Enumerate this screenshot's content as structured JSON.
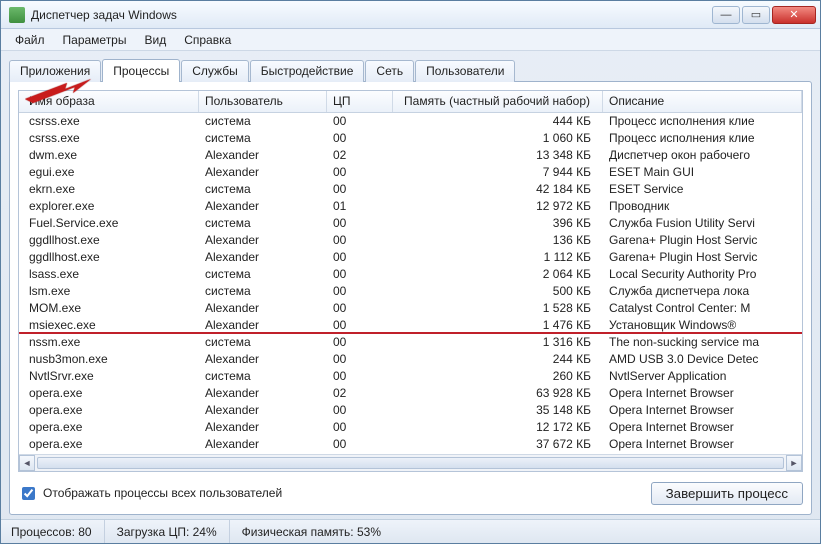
{
  "window": {
    "title": "Диспетчер задач Windows"
  },
  "menu": [
    "Файл",
    "Параметры",
    "Вид",
    "Справка"
  ],
  "tabs": [
    {
      "label": "Приложения",
      "active": false
    },
    {
      "label": "Процессы",
      "active": true
    },
    {
      "label": "Службы",
      "active": false
    },
    {
      "label": "Быстродействие",
      "active": false
    },
    {
      "label": "Сеть",
      "active": false
    },
    {
      "label": "Пользователи",
      "active": false
    }
  ],
  "columns": {
    "name": "Имя образа",
    "user": "Пользователь",
    "cpu": "ЦП",
    "mem": "Память (частный рабочий набор)",
    "desc": "Описание"
  },
  "processes": [
    {
      "name": "csrss.exe",
      "user": "система",
      "cpu": "00",
      "mem": "444 КБ",
      "desc": "Процесс исполнения клие"
    },
    {
      "name": "csrss.exe",
      "user": "система",
      "cpu": "00",
      "mem": "1 060 КБ",
      "desc": "Процесс исполнения клие"
    },
    {
      "name": "dwm.exe",
      "user": "Alexander",
      "cpu": "02",
      "mem": "13 348 КБ",
      "desc": "Диспетчер окон рабочего"
    },
    {
      "name": "egui.exe",
      "user": "Alexander",
      "cpu": "00",
      "mem": "7 944 КБ",
      "desc": "ESET Main GUI"
    },
    {
      "name": "ekrn.exe",
      "user": "система",
      "cpu": "00",
      "mem": "42 184 КБ",
      "desc": "ESET Service"
    },
    {
      "name": "explorer.exe",
      "user": "Alexander",
      "cpu": "01",
      "mem": "12 972 КБ",
      "desc": "Проводник"
    },
    {
      "name": "Fuel.Service.exe",
      "user": "система",
      "cpu": "00",
      "mem": "396 КБ",
      "desc": "Служба Fusion Utility Servi"
    },
    {
      "name": "ggdllhost.exe",
      "user": "Alexander",
      "cpu": "00",
      "mem": "136 КБ",
      "desc": "Garena+ Plugin Host Servic"
    },
    {
      "name": "ggdllhost.exe",
      "user": "Alexander",
      "cpu": "00",
      "mem": "1 112 КБ",
      "desc": "Garena+ Plugin Host Servic"
    },
    {
      "name": "lsass.exe",
      "user": "система",
      "cpu": "00",
      "mem": "2 064 КБ",
      "desc": "Local Security Authority Pro"
    },
    {
      "name": "lsm.exe",
      "user": "система",
      "cpu": "00",
      "mem": "500 КБ",
      "desc": "Служба диспетчера лока"
    },
    {
      "name": "MOM.exe",
      "user": "Alexander",
      "cpu": "00",
      "mem": "1 528 КБ",
      "desc": "Catalyst Control Center: M"
    },
    {
      "name": "msiexec.exe",
      "user": "Alexander",
      "cpu": "00",
      "mem": "1 476 КБ",
      "desc": "Установщик Windows®",
      "highlight": true
    },
    {
      "name": "nssm.exe",
      "user": "система",
      "cpu": "00",
      "mem": "1 316 КБ",
      "desc": "The non-sucking service ma"
    },
    {
      "name": "nusb3mon.exe",
      "user": "Alexander",
      "cpu": "00",
      "mem": "244 КБ",
      "desc": "AMD USB 3.0 Device Detec"
    },
    {
      "name": "NvtlSrvr.exe",
      "user": "система",
      "cpu": "00",
      "mem": "260 КБ",
      "desc": "NvtlServer Application"
    },
    {
      "name": "opera.exe",
      "user": "Alexander",
      "cpu": "02",
      "mem": "63 928 КБ",
      "desc": "Opera Internet Browser"
    },
    {
      "name": "opera.exe",
      "user": "Alexander",
      "cpu": "00",
      "mem": "35 148 КБ",
      "desc": "Opera Internet Browser"
    },
    {
      "name": "opera.exe",
      "user": "Alexander",
      "cpu": "00",
      "mem": "12 172 КБ",
      "desc": "Opera Internet Browser"
    },
    {
      "name": "opera.exe",
      "user": "Alexander",
      "cpu": "00",
      "mem": "37 672 КБ",
      "desc": "Opera Internet Browser"
    }
  ],
  "checkbox": {
    "label": "Отображать процессы всех пользователей",
    "checked": true
  },
  "end_button": "Завершить процесс",
  "status": {
    "processes": "Процессов: 80",
    "cpu": "Загрузка ЦП: 24%",
    "mem": "Физическая память: 53%"
  }
}
